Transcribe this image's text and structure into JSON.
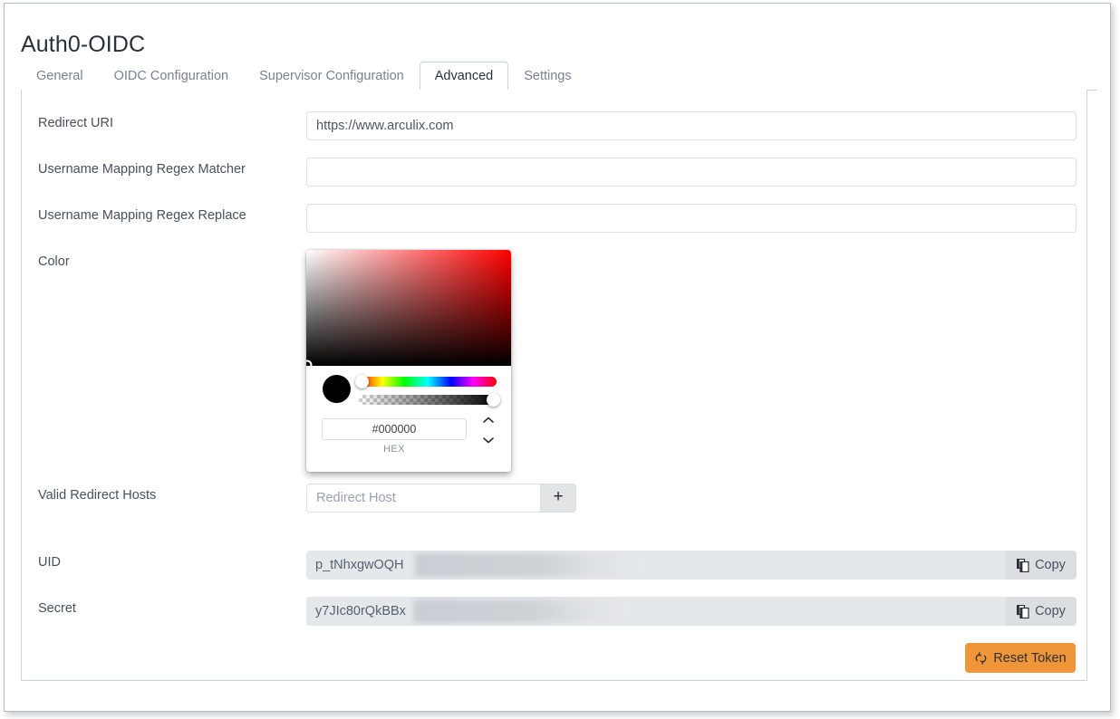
{
  "page": {
    "title": "Auth0-OIDC"
  },
  "tabs": [
    {
      "label": "General",
      "active": false
    },
    {
      "label": "OIDC Configuration",
      "active": false
    },
    {
      "label": "Supervisor Configuration",
      "active": false
    },
    {
      "label": "Advanced",
      "active": true
    },
    {
      "label": "Settings",
      "active": false
    }
  ],
  "fields": {
    "redirect_uri": {
      "label": "Redirect URI",
      "value": "https://www.arculix.com",
      "placeholder": ""
    },
    "username_mapping_regex_matcher": {
      "label": "Username Mapping Regex Matcher",
      "value": "",
      "placeholder": ""
    },
    "username_mapping_regex_replace": {
      "label": "Username Mapping Regex Replace",
      "value": "",
      "placeholder": ""
    },
    "color": {
      "label": "Color",
      "hex_value": "#000000",
      "format_label": "HEX",
      "swatch_color": "#000000",
      "hue_value": 0,
      "alpha_value": 100
    },
    "valid_redirect_hosts": {
      "label": "Valid Redirect Hosts",
      "value": "",
      "placeholder": "Redirect Host",
      "add_button_label": "+"
    },
    "uid": {
      "label": "UID",
      "value": "p_tNhxgwOQH",
      "redacted": true,
      "copy_label": "Copy"
    },
    "secret": {
      "label": "Secret",
      "value": "y7JIc80rQkBBx",
      "redacted": true,
      "copy_label": "Copy"
    }
  },
  "actions": {
    "reset_token_label": "Reset Token"
  },
  "icons": {
    "copy": "copy-icon",
    "reset": "refresh-icon",
    "add": "plus-icon",
    "stepper_up": "chevron-up-icon",
    "stepper_down": "chevron-down-icon"
  },
  "colors": {
    "accent_orange": "#ef9638",
    "panel_border": "#ccd1d9",
    "text_primary": "#2b2f38",
    "text_secondary": "#7b8190",
    "readonly_bg": "#e5e8ea"
  }
}
